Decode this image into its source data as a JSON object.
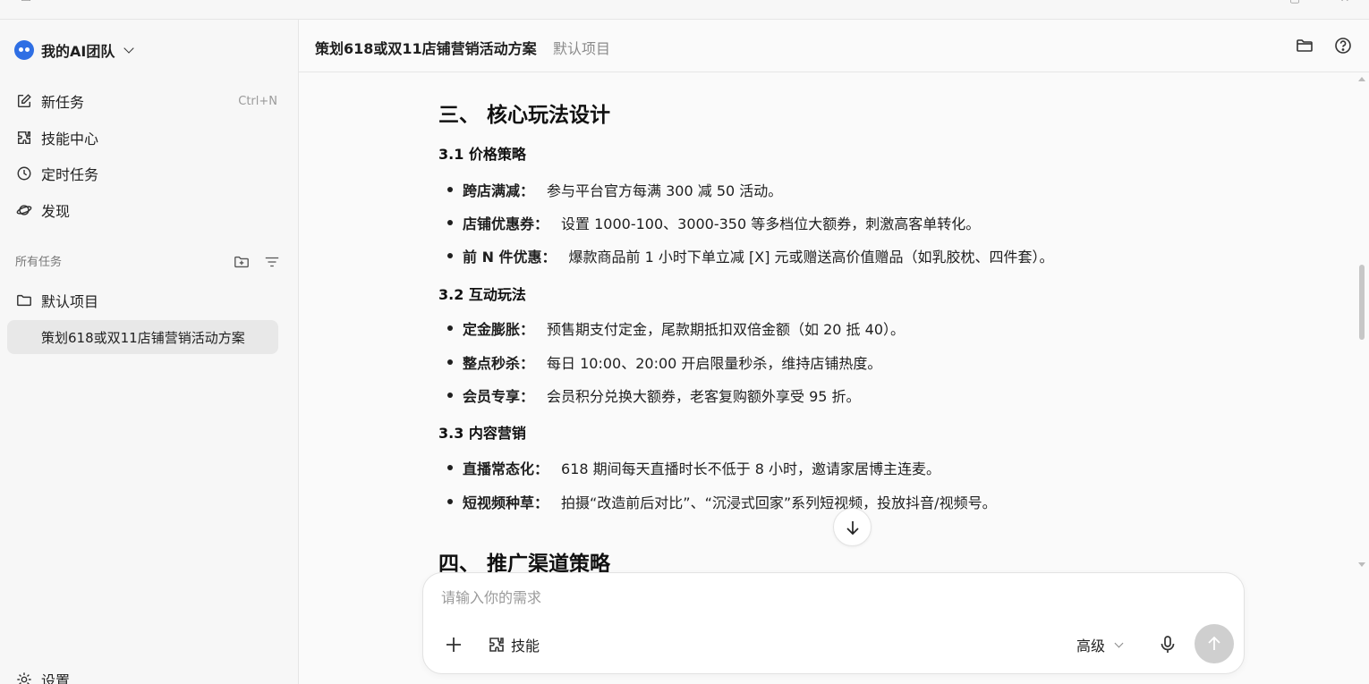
{
  "sidebar": {
    "team_name": "我的AI团队",
    "nav": [
      {
        "label": "新任务",
        "shortcut": "Ctrl+N",
        "icon": "edit-icon"
      },
      {
        "label": "技能中心",
        "icon": "puzzle-icon"
      },
      {
        "label": "定时任务",
        "icon": "clock-icon"
      },
      {
        "label": "发现",
        "icon": "planet-icon"
      }
    ],
    "section_label": "所有任务",
    "project_name": "默认项目",
    "active_task": "策划618或双11店铺营销活动方案",
    "settings_label": "设置"
  },
  "header": {
    "task_title": "策划618或双11店铺营销活动方案",
    "project_tag": "默认项目"
  },
  "doc": {
    "h2_core": "三、 核心玩法设计",
    "s31_title": "3.1 价格策略",
    "s31_items": [
      {
        "term": "跨店满减：",
        "text": "参与平台官方每满 300 减 50 活动。"
      },
      {
        "term": "店铺优惠券：",
        "text": "设置 1000-100、3000-350 等多档位大额券，刺激高客单转化。"
      },
      {
        "term": "前 N 件优惠：",
        "text": "爆款商品前 1 小时下单立减 [X] 元或赠送高价值赠品（如乳胶枕、四件套）。"
      }
    ],
    "s32_title": "3.2 互动玩法",
    "s32_items": [
      {
        "term": "定金膨胀：",
        "text": "预售期支付定金，尾款期抵扣双倍金额（如 20 抵 40）。"
      },
      {
        "term": "整点秒杀：",
        "text": "每日 10:00、20:00 开启限量秒杀，维持店铺热度。"
      },
      {
        "term": "会员专享：",
        "text": "会员积分兑换大额券，老客复购额外享受 95 折。"
      }
    ],
    "s33_title": "3.3 内容营销",
    "s33_items": [
      {
        "term": "直播常态化：",
        "text": "618 期间每天直播时长不低于 8 小时，邀请家居博主连麦。"
      },
      {
        "term": "短视频种草：",
        "text": "拍摄“改造前后对比”、“沉浸式回家”系列短视频，投放抖音/视频号。"
      }
    ],
    "h2_channels": "四、 推广渠道策略"
  },
  "composer": {
    "placeholder": "请输入你的需求",
    "skill_label": "技能",
    "mode_label": "高级"
  },
  "colors": {
    "sidebar_bg": "#f7f7f7",
    "active_item_bg": "#e8e8e8",
    "send_disabled": "#cfcfcf",
    "avatar_blue": "#2f6fe4"
  }
}
